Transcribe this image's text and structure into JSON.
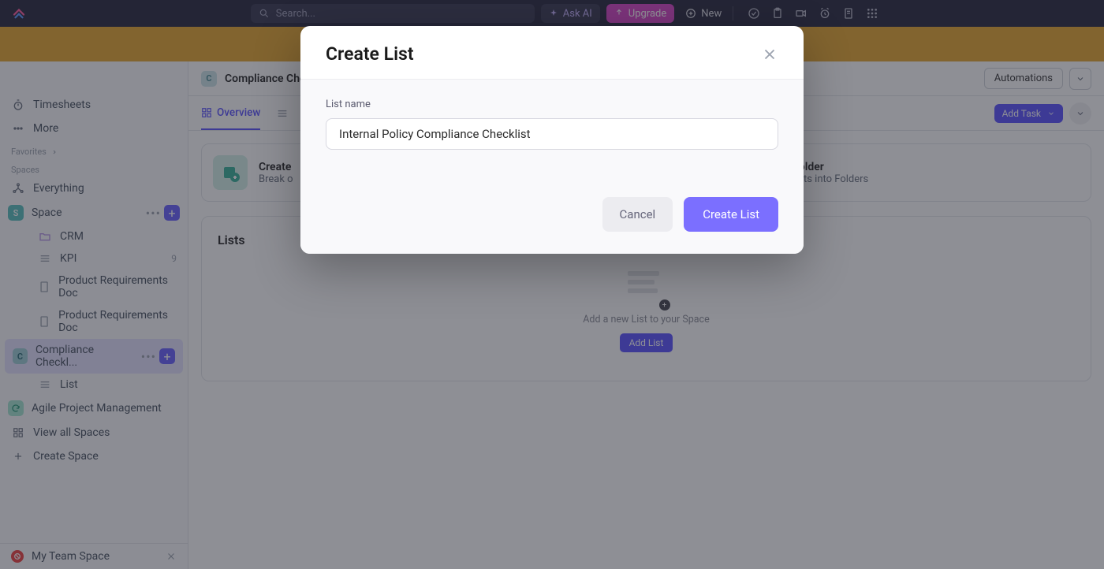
{
  "topbar": {
    "search_placeholder": "Search...",
    "ask_ai": "Ask AI",
    "upgrade": "Upgrade",
    "new": "New"
  },
  "sidebar": {
    "timesheets": "Timesheets",
    "more": "More",
    "favorites_label": "Favorites",
    "spaces_label": "Spaces",
    "everything": "Everything",
    "space_name": "Space",
    "items": {
      "crm": "CRM",
      "kpi": "KPI",
      "kpi_count": "9",
      "prd1": "Product Requirements Doc",
      "prd2": "Product Requirements Doc",
      "compliance": "Compliance Checkl...",
      "list": "List",
      "agile": "Agile Project Management",
      "view_all": "View all Spaces",
      "create_space": "Create Space"
    },
    "bottom_team": "My Team Space"
  },
  "crumb": {
    "chip": "C",
    "title": "Compliance Che",
    "automations": "Automations"
  },
  "tabs": {
    "overview": "Overview",
    "add_task": "Add Task"
  },
  "cards": {
    "list": {
      "title": "Create",
      "sub": "Break o"
    },
    "folder": {
      "title": "Create your first Folder",
      "sub": "Organize your projects into Folders"
    }
  },
  "lists": {
    "heading": "Lists",
    "empty_text": "Add a new List to your Space",
    "add_button": "Add List"
  },
  "modal": {
    "title": "Create List",
    "field_label": "List name",
    "input_value": "Internal Policy Compliance Checklist",
    "cancel": "Cancel",
    "submit": "Create List"
  }
}
